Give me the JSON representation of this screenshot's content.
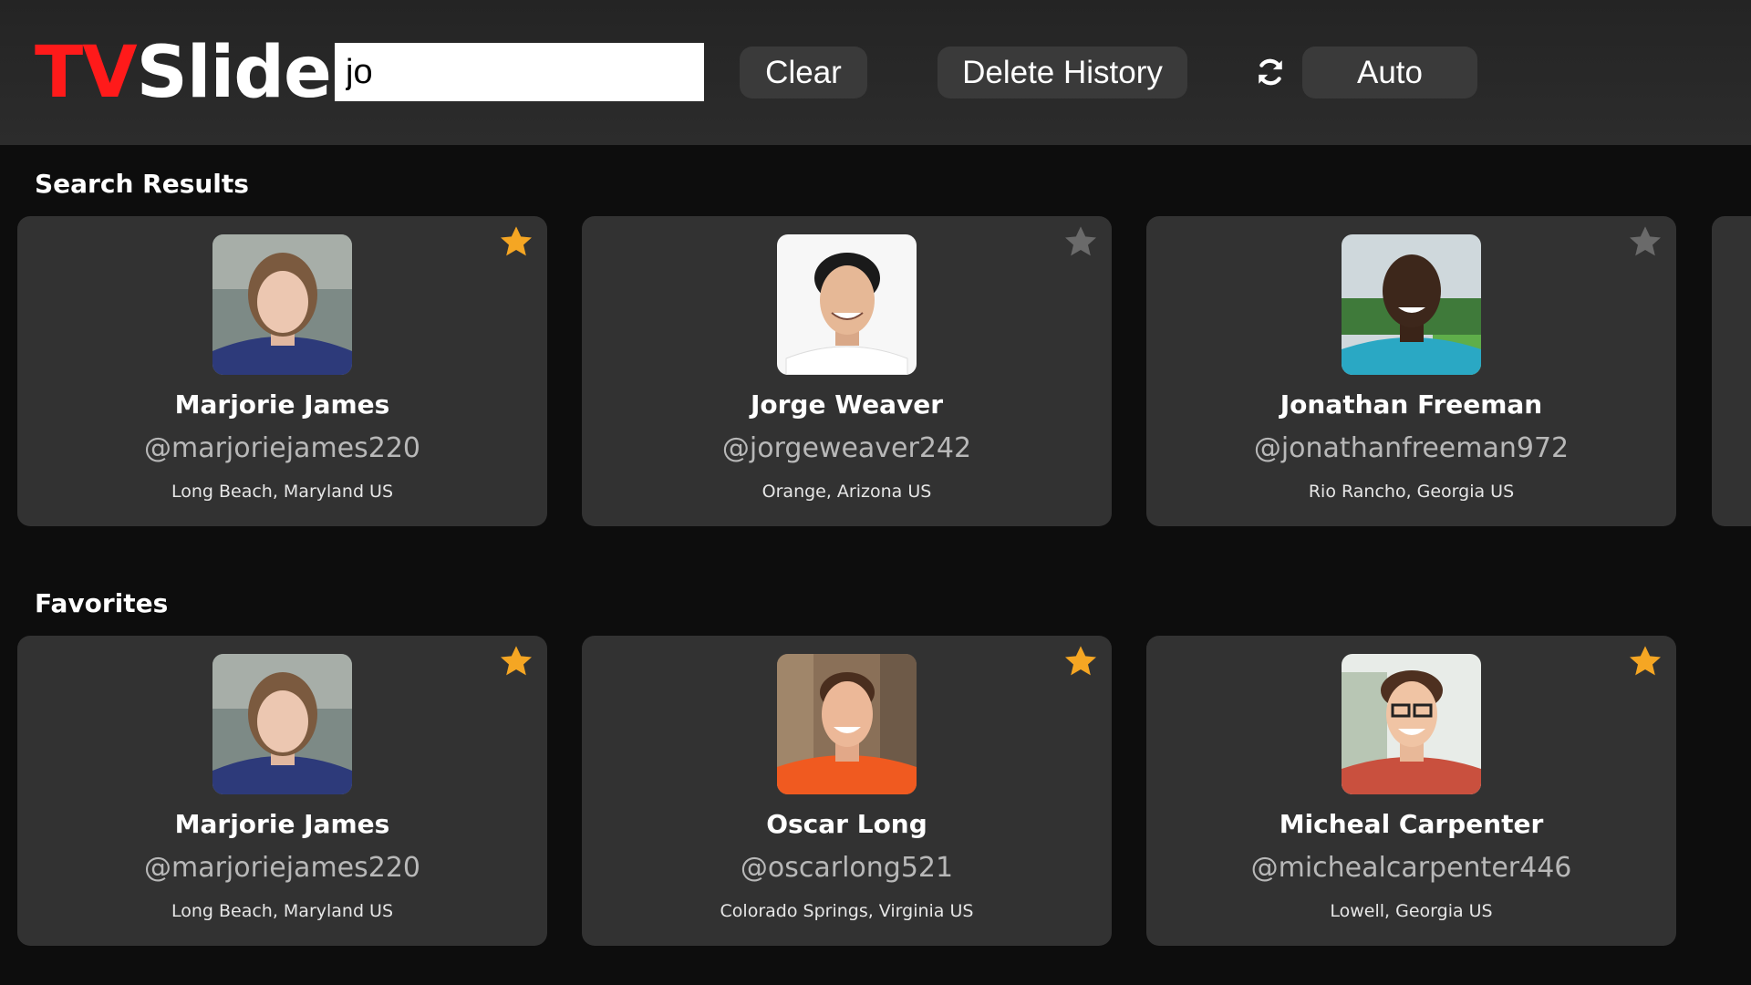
{
  "app": {
    "logo_part1": "TV",
    "logo_part2": "Slide",
    "accent_color": "#ff1a1a"
  },
  "toolbar": {
    "search_value": "jo",
    "clear_label": "Clear",
    "delete_history_label": "Delete History",
    "refresh_icon": "refresh-icon",
    "auto_label": "Auto"
  },
  "search_results": {
    "title": "Search Results",
    "cards": [
      {
        "name": "Marjorie James",
        "handle": "@marjoriejames220",
        "location": "Long Beach, Maryland US",
        "favorited": true
      },
      {
        "name": "Jorge Weaver",
        "handle": "@jorgeweaver242",
        "location": "Orange, Arizona US",
        "favorited": false
      },
      {
        "name": "Jonathan Freeman",
        "handle": "@jonathanfreeman972",
        "location": "Rio Rancho, Georgia US",
        "favorited": false
      }
    ]
  },
  "favorites": {
    "title": "Favorites",
    "cards": [
      {
        "name": "Marjorie James",
        "handle": "@marjoriejames220",
        "location": "Long Beach, Maryland US",
        "favorited": true
      },
      {
        "name": "Oscar Long",
        "handle": "@oscarlong521",
        "location": "Colorado Springs, Virginia US",
        "favorited": true
      },
      {
        "name": "Micheal Carpenter",
        "handle": "@michealcarpenter446",
        "location": "Lowell, Georgia US",
        "favorited": true
      }
    ]
  },
  "colors": {
    "star_active": "#f5a623",
    "star_inactive": "#6a6a6a"
  }
}
